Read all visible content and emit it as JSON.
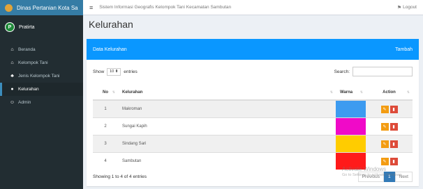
{
  "sidebar": {
    "brand": "Dinas Pertanian Kota Sa",
    "user_name": "Pratirta",
    "items": [
      {
        "label": "Beranda",
        "icon": "home-icon",
        "glyph": "⌂"
      },
      {
        "label": "Kelompok Tani",
        "icon": "home-icon",
        "glyph": "⌂"
      },
      {
        "label": "Jenis Kelompok Tani",
        "icon": "users-icon",
        "glyph": "♣"
      },
      {
        "label": "Kelurahan",
        "icon": "map-icon",
        "glyph": "●"
      },
      {
        "label": "Admin",
        "icon": "user-icon",
        "glyph": "☺"
      }
    ],
    "active_index": 3
  },
  "topbar": {
    "app_title": "Sistem Informasi Geografis Kelompok Tani Kecamatan Sambutan",
    "logout": "Logout"
  },
  "page": {
    "title": "Kelurahan"
  },
  "box": {
    "header_title": "Data Kelurahan",
    "add_label": "Tambah"
  },
  "controls": {
    "show_label": "Show",
    "show_value": "10",
    "entries_label": "entries",
    "search_label": "Search:"
  },
  "table": {
    "columns": [
      "No",
      "Kelurahan",
      "Warna",
      "Action"
    ],
    "rows": [
      {
        "no": "1",
        "kelurahan": "Makroman",
        "color": "#3d9bf0"
      },
      {
        "no": "2",
        "kelurahan": "Sungai Kapih",
        "color": "#f00ac8"
      },
      {
        "no": "3",
        "kelurahan": "Sindang Sari",
        "color": "#ffcc00"
      },
      {
        "no": "4",
        "kelurahan": "Sambutan",
        "color": "#ff1a1a"
      }
    ]
  },
  "footer": {
    "info": "Showing 1 to 4 of 4 entries",
    "prev": "Previous",
    "page": "1",
    "next": "Next"
  },
  "watermark": {
    "line1": "Activate Windows",
    "line2": "Go to Settings to activate Windows."
  }
}
